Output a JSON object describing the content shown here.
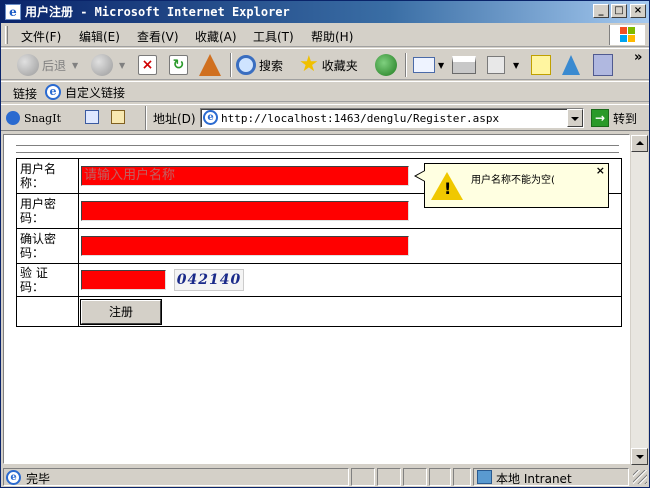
{
  "window": {
    "title": "用户注册 - Microsoft Internet Explorer",
    "min_label": "_",
    "max_label": "□",
    "close_label": "×"
  },
  "menu": {
    "items": [
      "文件(F)",
      "编辑(E)",
      "查看(V)",
      "收藏(A)",
      "工具(T)",
      "帮助(H)"
    ]
  },
  "toolbar": {
    "back_label": "后退",
    "search_label": "搜索",
    "favorites_label": "收藏夹",
    "more_label": "»"
  },
  "links": {
    "label": "链接",
    "custom_label": "自定义链接"
  },
  "addressbar": {
    "snagit_label": "SnagIt",
    "address_label": "地址(D)",
    "url": "http://localhost:1463/denglu/Register.aspx",
    "go_label": "转到"
  },
  "form": {
    "username_label": "用户名称：",
    "username_placeholder": "请输入用户名称",
    "password_label": "用户密码：",
    "confirm_label": "确认密码：",
    "captcha_label": "验 证 码：",
    "captcha_text": "042140",
    "register_label": "注册"
  },
  "tooltip": {
    "message": "用户名称不能为空(",
    "close": "×"
  },
  "statusbar": {
    "status": "完毕",
    "zone": "本地 Intranet"
  },
  "colors": {
    "input_bg": "#ff0000",
    "tooltip_bg": "#ffffe1",
    "titlebar": "#0a246a"
  }
}
